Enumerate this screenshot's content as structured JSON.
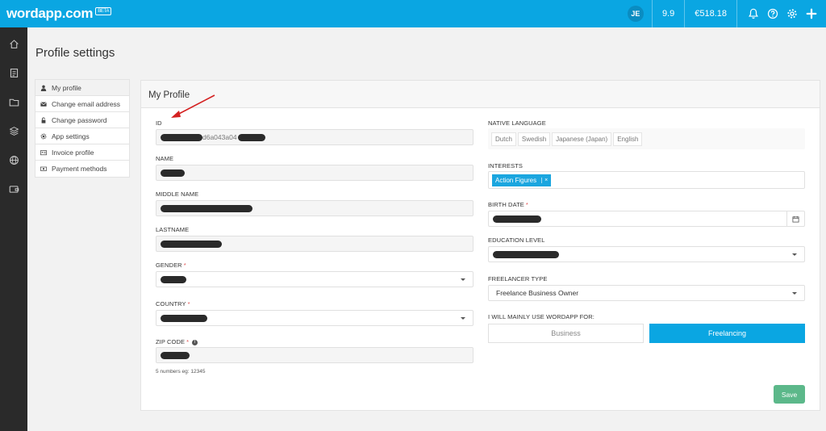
{
  "topbar": {
    "logo": "wordapp.com",
    "beta": "BETA",
    "avatar": "JE",
    "score": "9.9",
    "balance": "€518.18",
    "icons": [
      "bell-icon",
      "help-icon",
      "gear-icon",
      "plus-icon"
    ],
    "color": "#0aa6e2"
  },
  "sidebar": {
    "icons": [
      "home-icon",
      "document-icon",
      "folder-icon",
      "layers-icon",
      "globe-icon",
      "wallet-icon"
    ],
    "color": "#2a2a2a"
  },
  "page_title": "Profile settings",
  "settings_nav": [
    {
      "label": "My profile",
      "icon": "user-icon",
      "active": true
    },
    {
      "label": "Change email address",
      "icon": "envelope-icon",
      "active": false
    },
    {
      "label": "Change password",
      "icon": "lock-icon",
      "active": false
    },
    {
      "label": "App settings",
      "icon": "gear-icon",
      "active": false
    },
    {
      "label": "Invoice profile",
      "icon": "id-card-icon",
      "active": false
    },
    {
      "label": "Payment methods",
      "icon": "money-icon",
      "active": false
    }
  ],
  "panel": {
    "title": "My Profile",
    "left": {
      "id_label": "ID",
      "id_value": "d6a043a04",
      "name_label": "NAME",
      "middle_name_label": "MIDDLE NAME",
      "lastname_label": "LASTNAME",
      "gender_label": "GENDER",
      "country_label": "COUNTRY",
      "zip_label": "ZIP CODE",
      "zip_hint": "5 numbers eg: 12345"
    },
    "right": {
      "native_language_label": "NATIVE LANGUAGE",
      "languages": [
        "Dutch",
        "Swedish",
        "Japanese (Japan)",
        "English"
      ],
      "interests_label": "INTERESTS",
      "interest_tag": "Action Figures",
      "interest_tag_remove": "×",
      "birth_date_label": "BIRTH DATE",
      "education_label": "EDUCATION LEVEL",
      "freelancer_type_label": "FREELANCER TYPE",
      "freelancer_type_value": "Freelance Business Owner",
      "usage_label": "I WILL MAINLY USE WORDAPP FOR:",
      "usage_options": [
        "Business",
        "Freelancing"
      ],
      "usage_selected": "Freelancing"
    },
    "save_label": "Save",
    "accent": "#5cb88a"
  }
}
